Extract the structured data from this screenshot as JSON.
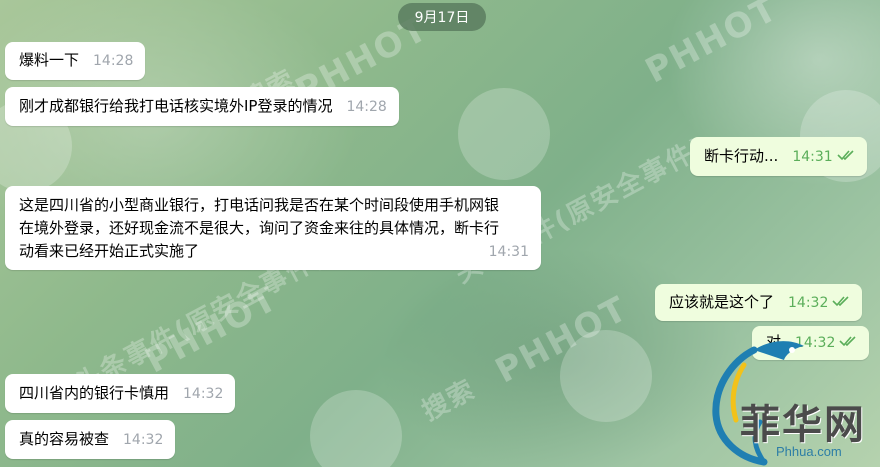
{
  "date_divider": "9月17日",
  "watermarks": {
    "brand_en": "PHHOT",
    "brand_cn": "头条事件(原安全事件)",
    "search_cn": "搜索",
    "logo_cn": "头条"
  },
  "messages": [
    {
      "text": "爆料一下",
      "time": "14:28",
      "direction": "incoming"
    },
    {
      "text": "刚才成都银行给我打电话核实境外IP登录的情况",
      "time": "14:28",
      "direction": "incoming"
    },
    {
      "text": "断卡行动...",
      "time": "14:31",
      "direction": "outgoing",
      "status": "read"
    },
    {
      "text": "这是四川省的小型商业银行，打电话问我是否在某个时间段使用手机网银在境外登录，还好现金流不是很大，询问了资金来往的具体情况，断卡行动看来已经开始正式实施了",
      "time": "14:31",
      "direction": "incoming"
    },
    {
      "text": "应该就是这个了",
      "time": "14:32",
      "direction": "outgoing",
      "status": "read"
    },
    {
      "text": "对",
      "time": "14:32",
      "direction": "outgoing",
      "status": "read"
    },
    {
      "text": "四川省内的银行卡慎用",
      "time": "14:32",
      "direction": "incoming"
    },
    {
      "text": "真的容易被查",
      "time": "14:32",
      "direction": "incoming"
    }
  ],
  "site_logo": {
    "name": "菲华网",
    "url": "Phhua.com"
  },
  "colors": {
    "incoming_bubble": "#ffffff",
    "outgoing_bubble": "#effdde",
    "outgoing_time": "#5bae5a",
    "incoming_time": "#a0a6ad",
    "date_pill": "#5a7d5f"
  }
}
